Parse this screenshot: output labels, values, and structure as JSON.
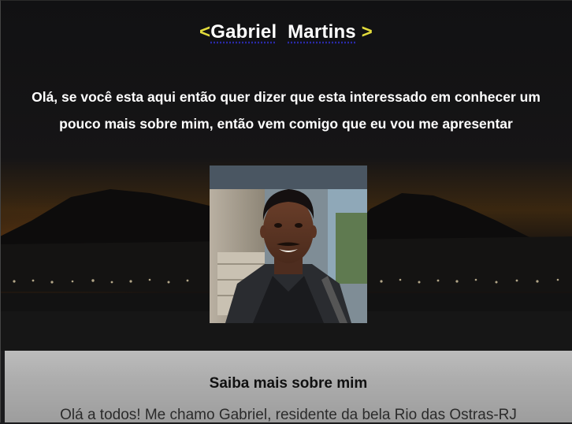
{
  "header": {
    "bracket_open": "<",
    "first_name": "Gabriel",
    "last_name": "Martins",
    "bracket_close": ">"
  },
  "intro": {
    "text": "Olá, se você esta aqui então quer dizer que esta interessado em conhecer um pouco mais sobre mim, então vem comigo que eu vou me apresentar"
  },
  "profile_photo": {
    "description_icon": "profile-photo"
  },
  "about": {
    "title": "Saiba mais sobre mim",
    "text": "Olá a todos! Me chamo Gabriel, residente da bela Rio das Ostras-RJ"
  },
  "colors": {
    "bracket": "#e3dc3c",
    "text": "#ffffff",
    "about_bg": "#b0b0b0"
  }
}
